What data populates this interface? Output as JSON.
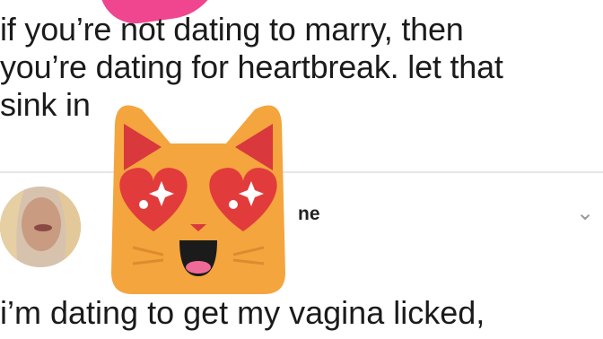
{
  "post": {
    "text": "if you’re not dating to marry, then\nyou’re dating for heartbreak. let that\nsink in"
  },
  "reply": {
    "author_name_fragment": "ne",
    "text": "i’m dating to get my vagina licked,"
  },
  "icons": {
    "chevron": "chevron-down-icon",
    "sticker": "heart-eyes-cat-sticker"
  },
  "colors": {
    "sticker_orange": "#f4a53d",
    "heart_red": "#e23b3b",
    "ear_red": "#d9383d",
    "blob_pink": "#f0468f"
  }
}
